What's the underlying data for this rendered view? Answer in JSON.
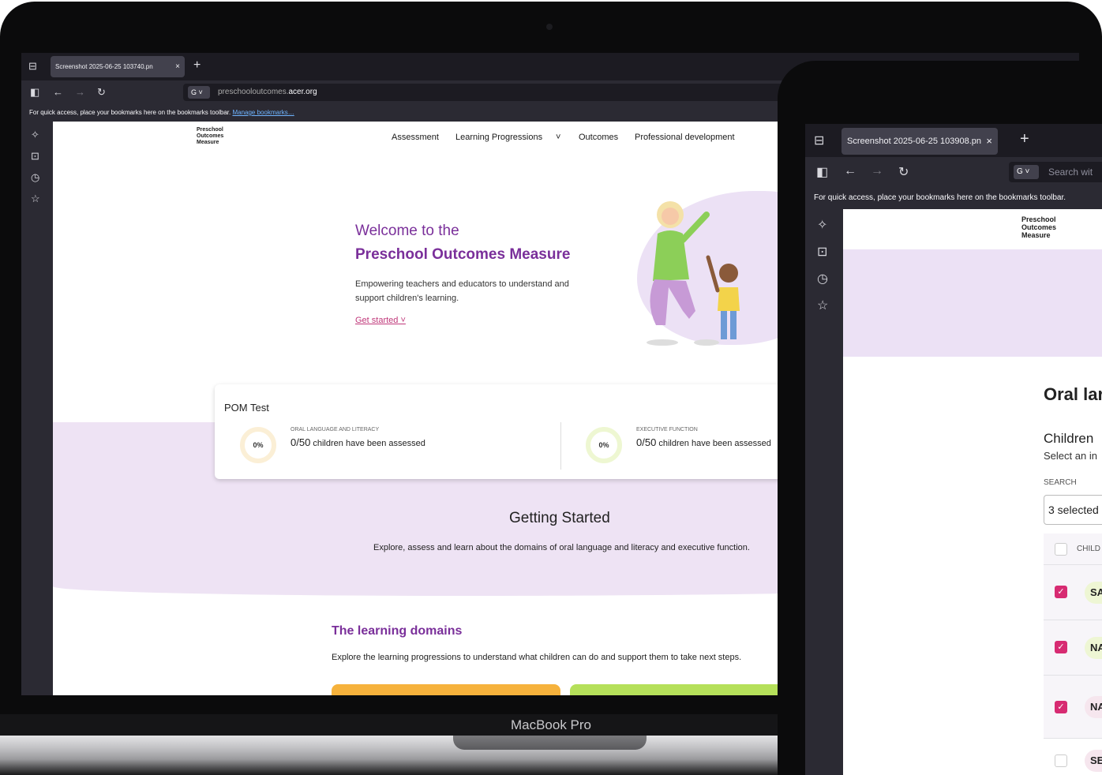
{
  "laptop": {
    "brand": "MacBook Pro",
    "browser": {
      "tab_title": "Screenshot 2025-06-25 103740.pn",
      "tab_close": "×",
      "new_tab": "+",
      "url_prefix": "preschooloutcomes.",
      "url_domain": "acer.org",
      "bookmarks_text": "For quick access, place your bookmarks here on the bookmarks toolbar.",
      "bookmarks_link": "Manage bookmarks…"
    },
    "site": {
      "logo": [
        "Preschool",
        "Outcomes",
        "Measure"
      ],
      "nav": [
        "Assessment",
        "Learning Progressions",
        "Outcomes",
        "Professional development"
      ],
      "hero": {
        "line1": "Welcome to the",
        "line2": "Preschool Outcomes Measure",
        "copy": "Empowering teachers and educators to understand and support children's learning.",
        "cta": "Get started"
      },
      "pom": {
        "title": "POM Test",
        "domains": [
          {
            "label": "ORAL LANGUAGE AND LITERACY",
            "percent": "0%",
            "count": "0/50",
            "text": "children have been assessed"
          },
          {
            "label": "EXECUTIVE FUNCTION",
            "percent": "0%",
            "count": "0/50",
            "text": "children have been assessed"
          }
        ]
      },
      "getting_started": {
        "title": "Getting Started",
        "copy": "Explore, assess and learn about the domains of oral language and literacy and executive function."
      },
      "learning_domains": {
        "title": "The learning domains",
        "copy": "Explore the learning progressions to understand what children can do and support them to take next steps."
      }
    }
  },
  "tablet": {
    "browser": {
      "tab_title": "Screenshot 2025-06-25 103908.pn",
      "tab_close": "×",
      "new_tab": "+",
      "url_placeholder": "Search wit",
      "bookmarks_text": "For quick access, place your bookmarks here on the bookmarks toolbar."
    },
    "site": {
      "logo": [
        "Preschool",
        "Outcomes",
        "Measure"
      ],
      "heading": "Oral lar",
      "subheading": "Children",
      "subtext": "Select an in",
      "search_label": "SEARCH",
      "search_value": "3 selected",
      "table_header": "CHILD",
      "rows": [
        {
          "initials": "SA",
          "checked": true,
          "color": "#eef6d4"
        },
        {
          "initials": "NA",
          "checked": true,
          "color": "#eef6d4"
        },
        {
          "initials": "NA",
          "checked": true,
          "color": "#f6e6ee"
        },
        {
          "initials": "SE",
          "checked": false,
          "color": "#f6e6ee"
        }
      ]
    }
  },
  "colors": {
    "purple": "#7a2f9a",
    "pink": "#c0387a",
    "lavender": "#ece1f5",
    "checkbox": "#d72b72"
  }
}
